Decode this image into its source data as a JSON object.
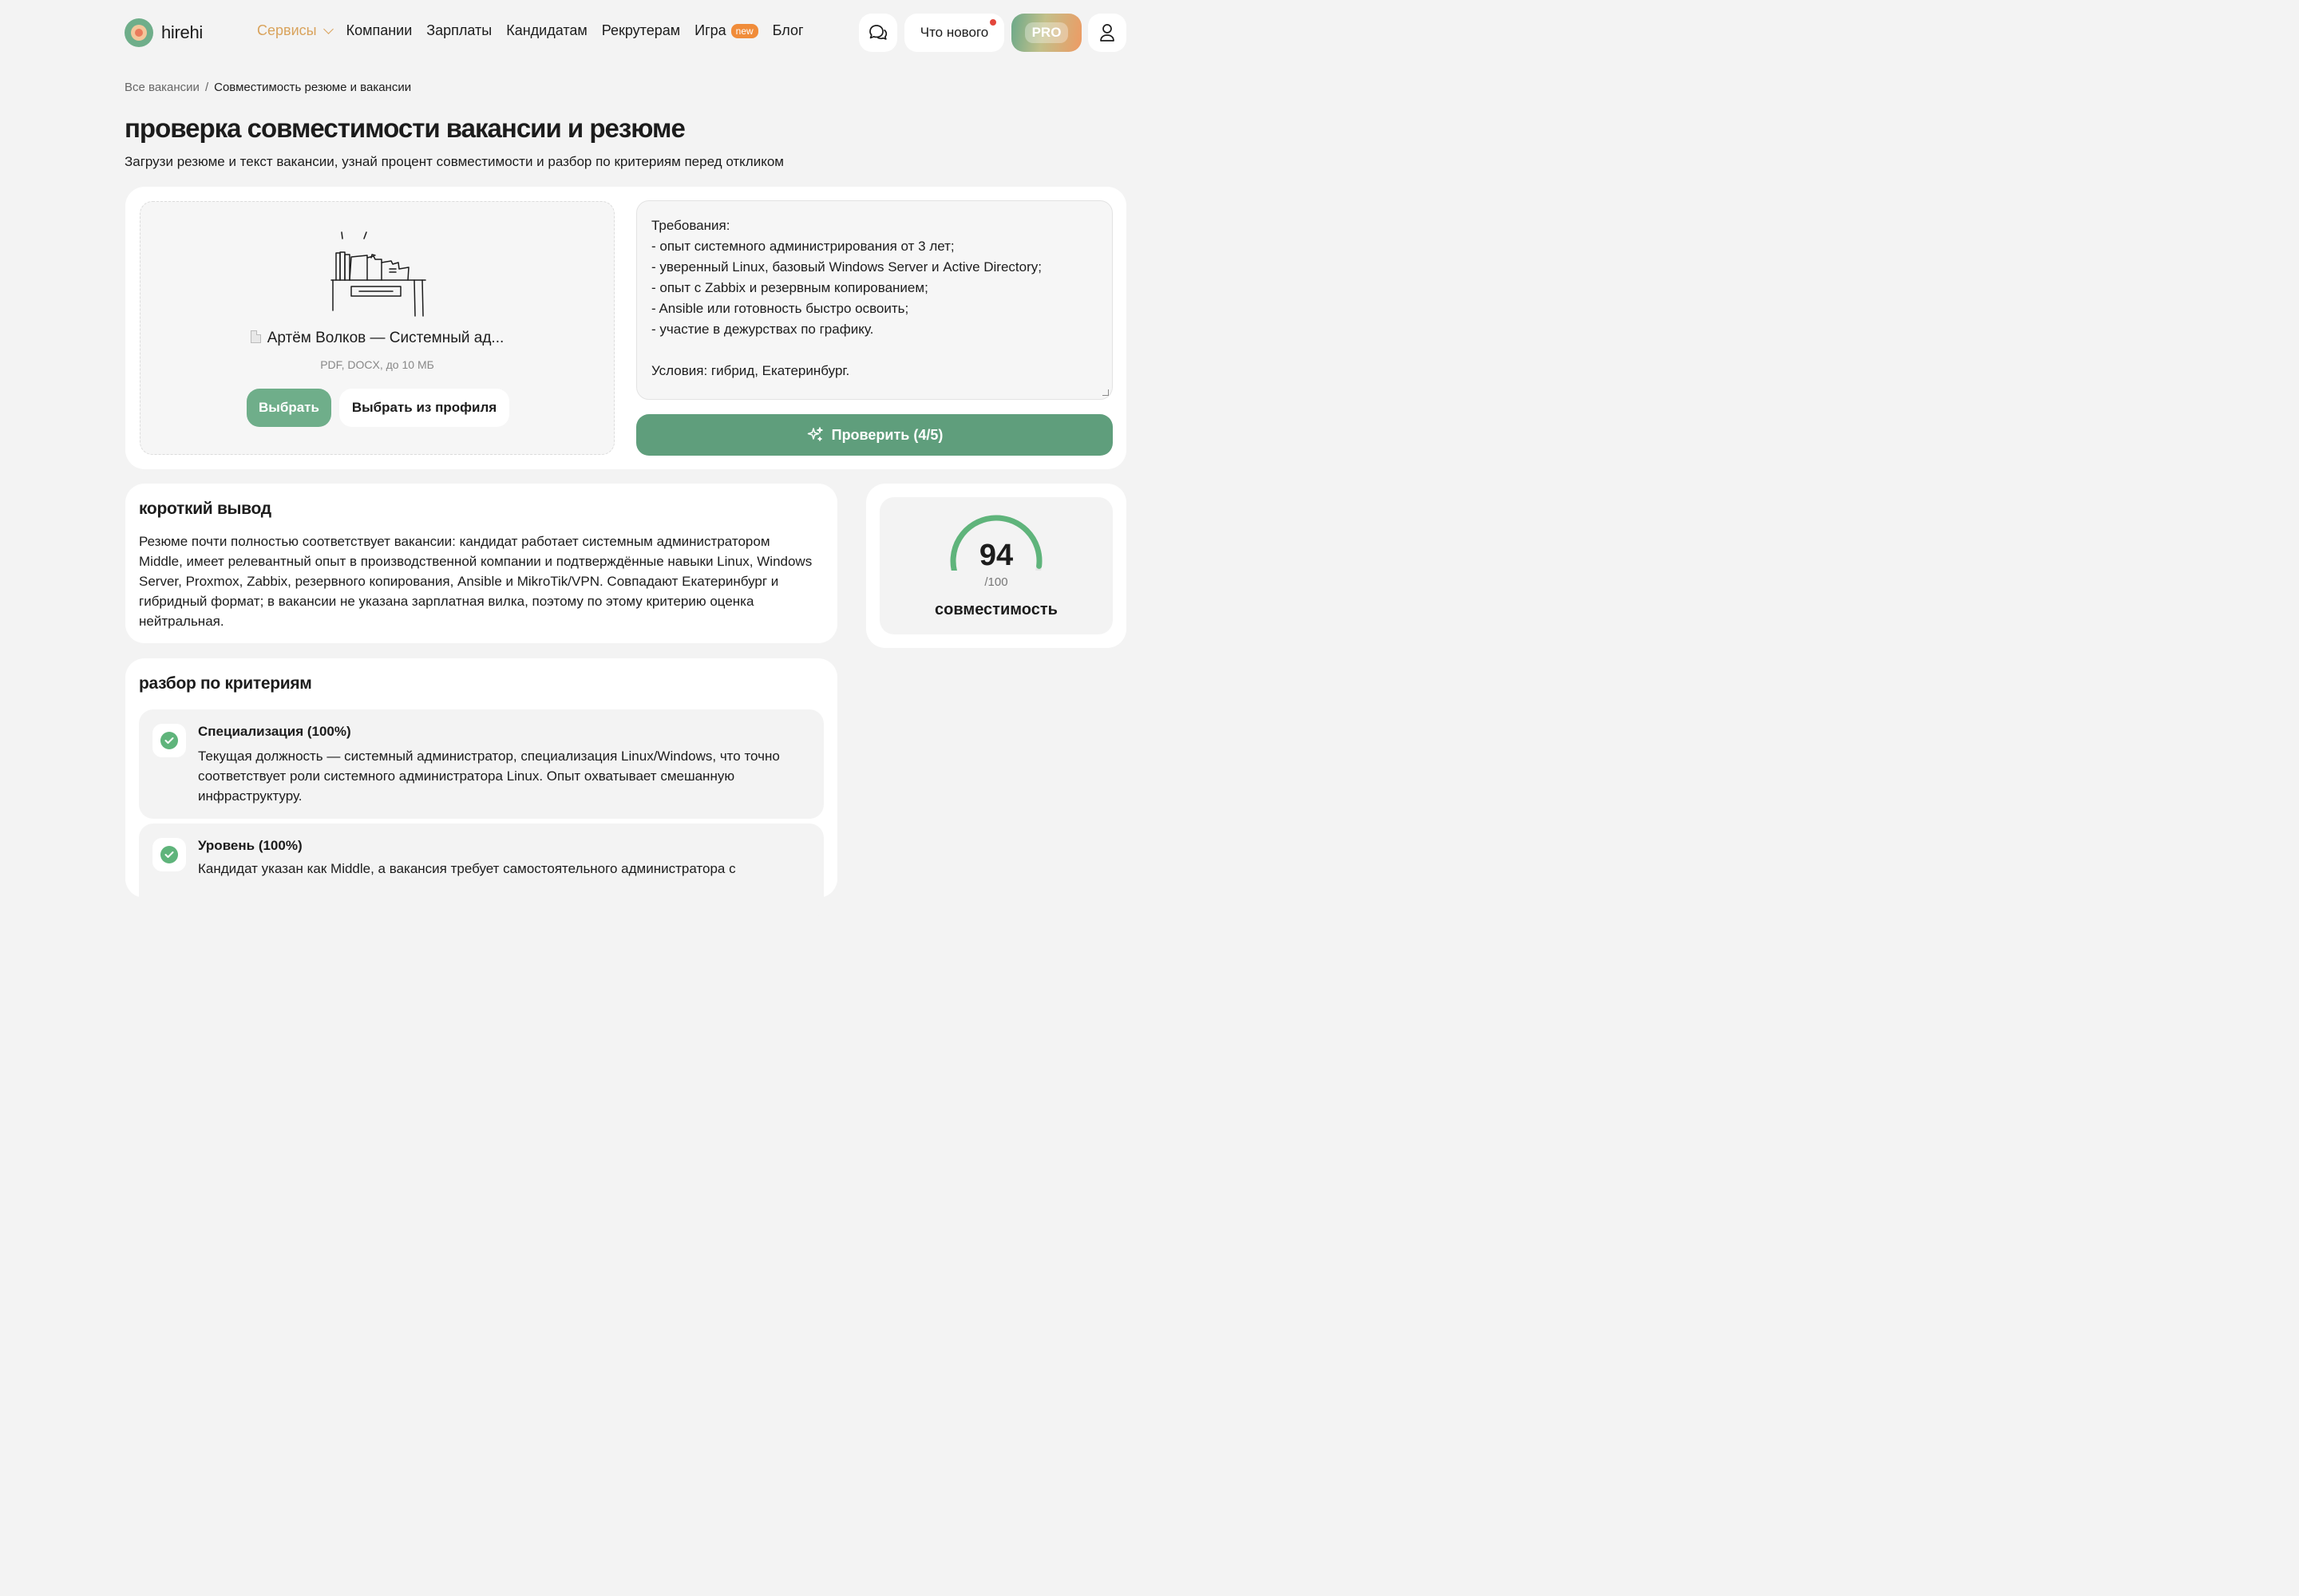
{
  "header": {
    "logo_text": "hirehi",
    "nav": [
      {
        "label": "Сервисы",
        "active": true
      },
      {
        "label": "Компании"
      },
      {
        "label": "Зарплаты"
      },
      {
        "label": "Кандидатам"
      },
      {
        "label": "Рекрутерам"
      },
      {
        "label": "Игра",
        "badge": "new"
      },
      {
        "label": "Блог"
      }
    ],
    "whats_new_label": "Что нового",
    "pro_label": "PRO"
  },
  "breadcrumbs": {
    "root": "Все вакансии",
    "separator": "/",
    "current": "Совместимость резюме и вакансии"
  },
  "page": {
    "title": "проверка совместимости вакансии и резюме",
    "subtitle": "Загрузи резюме и текст вакансии, узнай процент совместимости и разбор по критериям перед откликом"
  },
  "upload": {
    "file_name": "Артём Волков — Системный ад...",
    "hint": "PDF, DOCX, до 10 МБ",
    "choose_label": "Выбрать",
    "choose_profile_label": "Выбрать из профиля"
  },
  "vacancy_text": {
    "lines": [
      "Требования:",
      "- опыт системного администрирования от 3 лет;",
      "- уверенный Linux, базовый Windows Server и Active Directory;",
      "- опыт с Zabbix и резервным копированием;",
      "- Ansible или готовность быстро освоить;",
      "- участие в дежурствах по графику.",
      "",
      "Условия: гибрид, Екатеринбург."
    ]
  },
  "check_button_label": "Проверить (4/5)",
  "summary": {
    "title": "короткий вывод",
    "text": "Резюме почти полностью соответствует вакансии: кандидат работает системным администратором Middle, имеет релевантный опыт в производственной компании и подтверждённые навыки Linux, Windows Server, Proxmox, Zabbix, резервного копирования, Ansible и MikroTik/VPN. Совпадают Екатеринбург и гибридный формат; в вакансии не указана зарплатная вилка, поэтому по этому критерию оценка нейтральная."
  },
  "score": {
    "value": "94",
    "max": "/100",
    "label": "совместимость",
    "fraction": 0.94,
    "arc_color": "#5fb47b",
    "track_color": "#e6e6e6"
  },
  "criteria": {
    "title": "разбор по критериям",
    "items": [
      {
        "title": "Специализация (100%)",
        "desc": "Текущая должность — системный администратор, специализация Linux/Windows, что точно соответствует роли системного администратора Linux. Опыт охватывает смешанную инфраструктуру."
      },
      {
        "title": "Уровень (100%)",
        "desc": "Кандидат указан как Middle, а вакансия требует самостоятельного администратора с"
      }
    ]
  },
  "colors": {
    "accent_green": "#5f9e7c",
    "nav_active": "#d9a35c",
    "badge_orange": "#f08c3a",
    "notification_red": "#e3463b"
  }
}
